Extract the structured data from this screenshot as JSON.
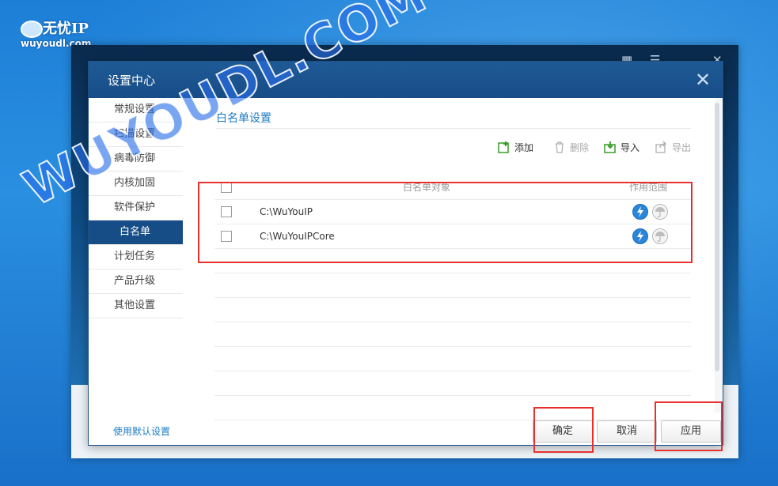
{
  "logo": {
    "title": "无忧IP",
    "subtitle": "wuyoudl.com"
  },
  "watermark": "WUYOUDL.COM",
  "dialog": {
    "title": "设置中心",
    "close_icon": "close-icon"
  },
  "sidebar": {
    "items": [
      {
        "label": "常规设置"
      },
      {
        "label": "扫描设置"
      },
      {
        "label": "病毒防御"
      },
      {
        "label": "内核加固"
      },
      {
        "label": "软件保护"
      },
      {
        "label": "白名单",
        "active": true
      },
      {
        "label": "计划任务"
      },
      {
        "label": "产品升级"
      },
      {
        "label": "其他设置"
      }
    ]
  },
  "section": {
    "title": "白名单设置"
  },
  "toolbar": {
    "add": {
      "label": "添加",
      "icon": "add-icon"
    },
    "delete": {
      "label": "删除",
      "icon": "trash-icon",
      "disabled": true
    },
    "import": {
      "label": "导入",
      "icon": "import-icon"
    },
    "export": {
      "label": "导出",
      "icon": "export-icon",
      "disabled": true
    }
  },
  "table": {
    "columns": [
      "白名单对象",
      "作用范围"
    ],
    "rows": [
      {
        "path": "C:\\WuYouIP"
      },
      {
        "path": "C:\\WuYouIPCore"
      }
    ],
    "scope_icons": [
      "lightning-icon",
      "umbrella-icon"
    ]
  },
  "footer": {
    "reset_link": "使用默认设置",
    "ok": "确定",
    "cancel": "取消",
    "apply": "应用"
  },
  "colors": {
    "header": "#174d87",
    "accent": "#1e7cc4",
    "highlight": "#e8312f"
  }
}
